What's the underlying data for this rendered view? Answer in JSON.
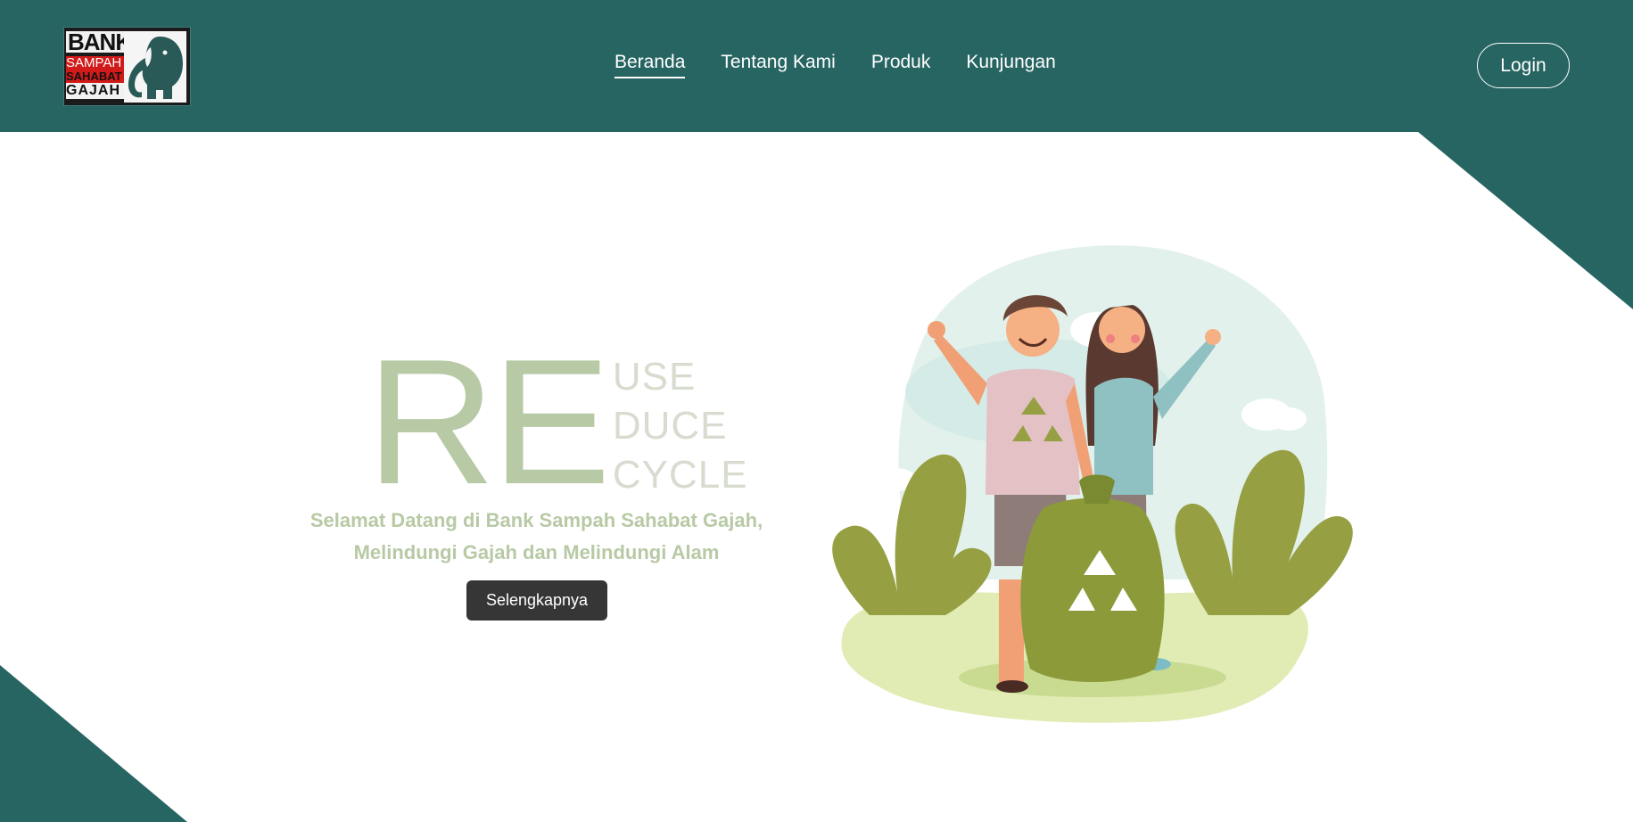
{
  "header": {
    "logo": {
      "line1": "BANK",
      "line2": "SAMPAH",
      "line3": "SAHABAT",
      "line4": "GAJAH",
      "icon": "elephant-logo"
    },
    "nav": [
      {
        "label": "Beranda",
        "active": true
      },
      {
        "label": "Tentang Kami",
        "active": false
      },
      {
        "label": "Produk",
        "active": false
      },
      {
        "label": "Kunjungan",
        "active": false
      }
    ],
    "login_label": "Login"
  },
  "hero": {
    "re": "RE",
    "words": [
      "USE",
      "DUCE",
      "CYCLE"
    ],
    "welcome_line1": "Selamat Datang di Bank Sampah Sahabat Gajah,",
    "welcome_line2": "Melindungi Gajah dan Melindungi Alam",
    "cta_label": "Selengkapnya",
    "illustration": "recycling-people-illustration"
  },
  "colors": {
    "primary": "#276562",
    "accent_green": "#b8c9a5",
    "faded_text": "#d7dccf",
    "button_dark": "#363636"
  }
}
